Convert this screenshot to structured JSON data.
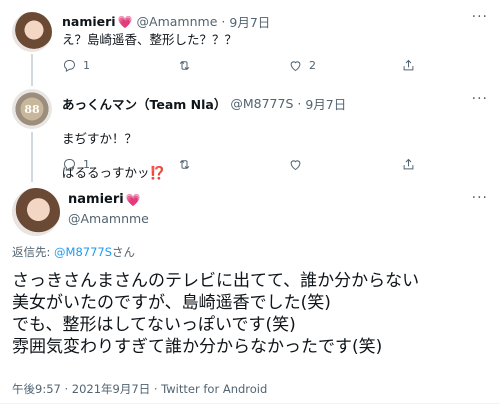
{
  "tweet1": {
    "name": "namieri",
    "handle": "@Amamnme",
    "date": "9月7日",
    "text": "え？島崎遥香、整形した？？？",
    "reply_count": "1",
    "retweet_count": "",
    "like_count": "2"
  },
  "tweet2": {
    "avatar_text": "88",
    "name": "あっくんマン（Team Nla）",
    "handle": "@M8777S",
    "date": "9月7日",
    "text_line1": "まぢすか！？",
    "text_line2": "ぱるるっすかッ",
    "text_emoji": "⁉️",
    "reply_count": "1",
    "retweet_count": "",
    "like_count": ""
  },
  "main_tweet": {
    "name": "namieri",
    "handle": "@Amamnme",
    "reply_prefix": "返信先: ",
    "reply_to": "@M8777S",
    "reply_suffix": "さん",
    "lines": [
      "さっきさんまさんのテレビに出てて、誰か分からない",
      "美女がいたのですが、島崎遥香でした(笑)",
      "でも、整形はしてないっぽいです(笑)",
      "雰囲気変わりすぎて誰か分からなかったです(笑)"
    ],
    "footer": "午後9:57 · 2021年9月7日 · Twitter for Android"
  },
  "icons": {
    "reply": "reply-icon",
    "retweet": "retweet-icon",
    "like": "heart-icon",
    "share": "share-icon",
    "more": "more-icon"
  },
  "colors": {
    "accent": "#1d9bf0",
    "heart": "#e0245e",
    "muted": "#536471"
  }
}
